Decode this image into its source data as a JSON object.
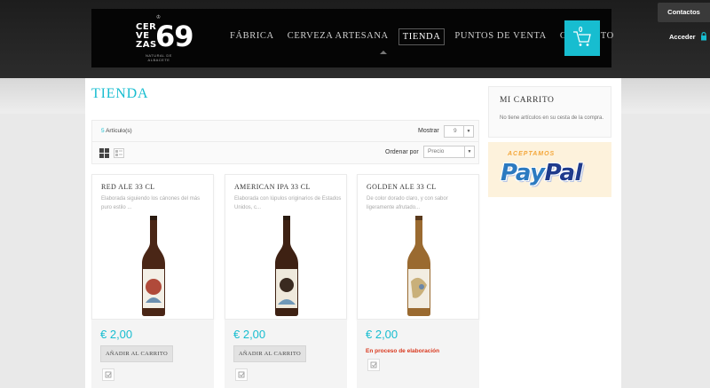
{
  "header": {
    "logo": {
      "line1": "CER",
      "line2": "VE",
      "line3": "ZAS",
      "number": "69",
      "subtitle": "NATURAL DE ALBACETE",
      "crown": "♔"
    },
    "nav": [
      "FÁBRICA",
      "CERVEZA ARTESANA",
      "TIENDA",
      "PUNTOS DE VENTA",
      "CONTACTO"
    ],
    "active_nav": "TIENDA",
    "cart_count": "0",
    "contactos": "Contactos",
    "acceder": "Acceder"
  },
  "page": {
    "title": "TIENDA",
    "article_count": "5",
    "article_label": "Artículo(s)",
    "show_label": "Mostrar",
    "show_value": "9",
    "sort_label": "Ordenar por",
    "sort_value": "Precio"
  },
  "products": [
    {
      "name": "RED ALE 33 CL",
      "desc": "Elaborada siguiendo los cánones del más puro estilo ...",
      "price": "€ 2,00",
      "action": "AÑADIR AL CARRITO",
      "label_color": "#b04a3a"
    },
    {
      "name": "AMERICAN IPA 33 CL",
      "desc": "Elaborada con lúpulos originarios de Estados Unidos, c...",
      "price": "€ 2,00",
      "action": "AÑADIR AL CARRITO",
      "label_color": "#3a2a20"
    },
    {
      "name": "GOLDEN ALE 33 CL",
      "desc": "De color dorado claro, y con sabor ligeramente afrutado...",
      "price": "€ 2,00",
      "status": "En proceso de elaboración",
      "label_color": "#c9b07a"
    }
  ],
  "sidebar": {
    "cart_title": "MI CARRITO",
    "cart_empty": "No tiene artículos en su cesta de la compra.",
    "paypal_accept": "ACEPTAMOS",
    "paypal_pay": "Pay",
    "paypal_pal": "Pal"
  },
  "colors": {
    "accent": "#17bdd0",
    "alert": "#d9381e",
    "paypal_blue": "#1f3b8c"
  }
}
